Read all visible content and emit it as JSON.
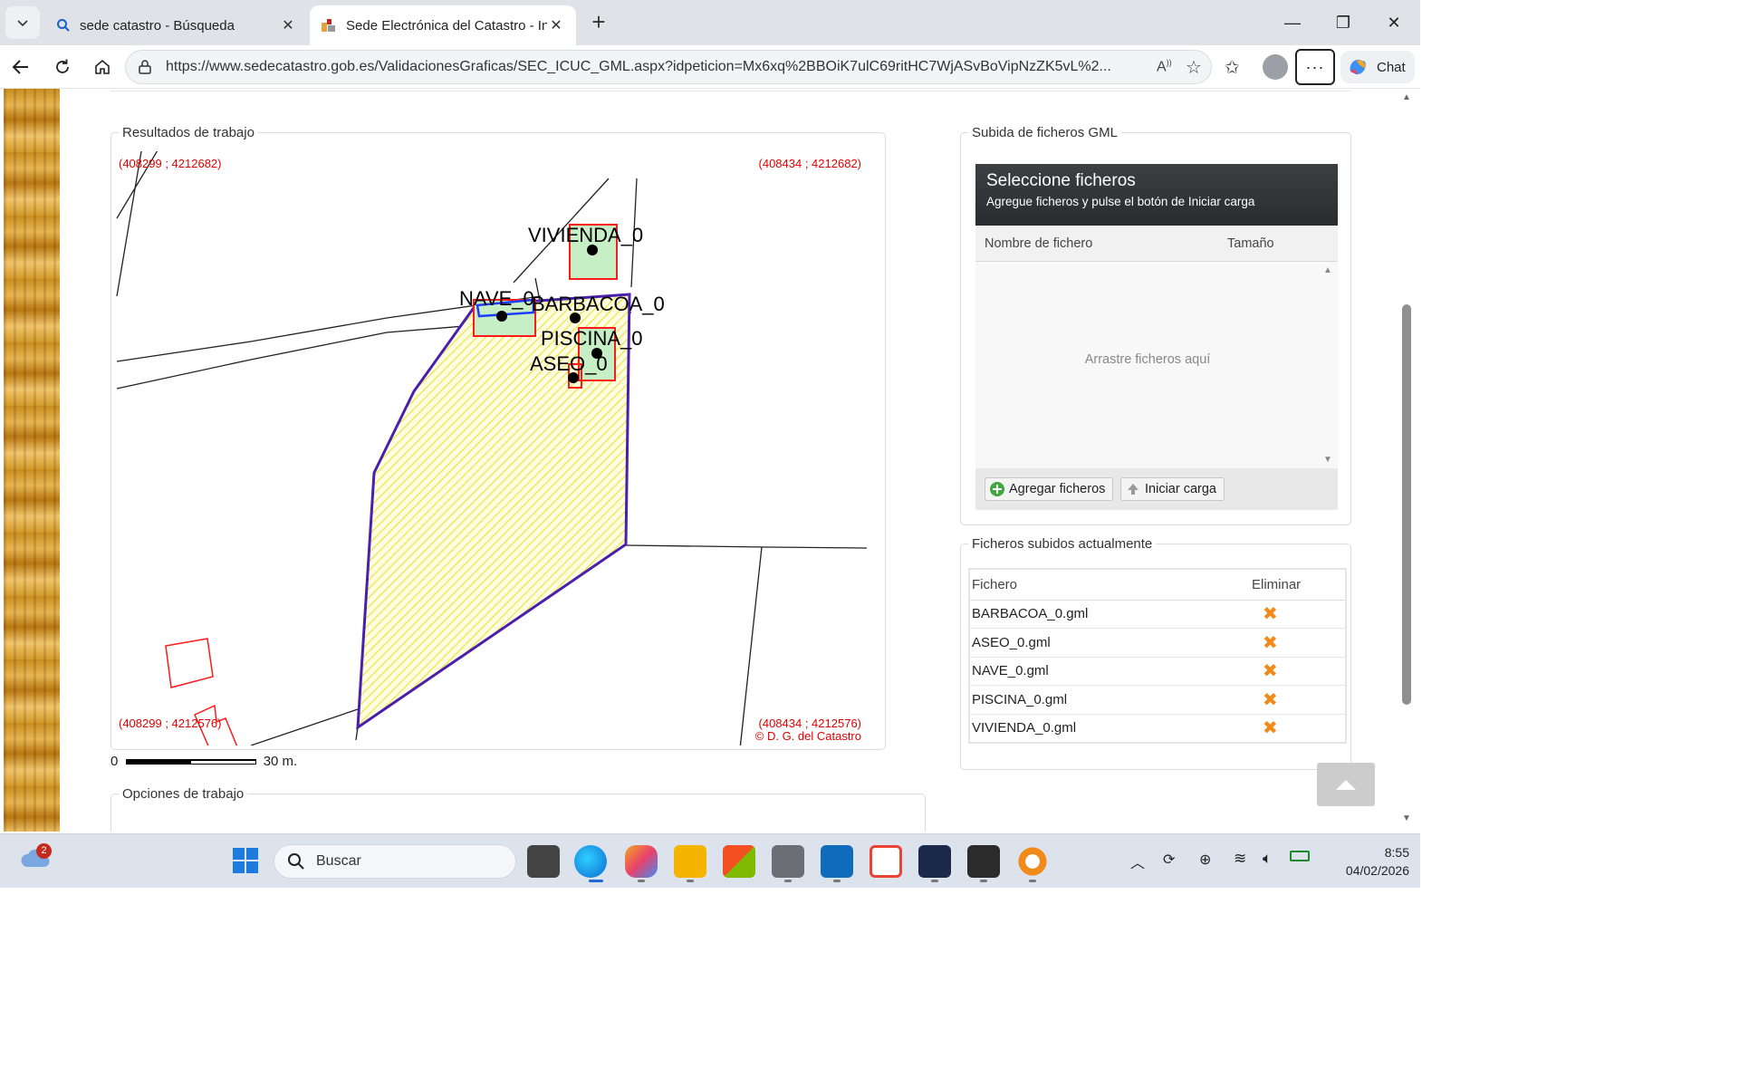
{
  "browser": {
    "tabs": [
      {
        "title": "sede catastro - Búsqueda",
        "active": false
      },
      {
        "title": "Sede Electrónica del Catastro - Información",
        "active": true
      }
    ],
    "url": "https://www.sedecatastro.gob.es/ValidacionesGraficas/SEC_ICUC_GML.aspx?idpeticion=Mx6xq%2BBOiK7ulC69ritHC7WjASvBoVipNzZK5vL%2...",
    "chat_label": "Chat"
  },
  "map": {
    "legend": "Resultados de trabajo",
    "coord_top_left": "(408299 ; 4212682)",
    "coord_top_right": "(408434 ; 4212682)",
    "coord_bottom_left": "(408299 ; 4212576)",
    "coord_bottom_right": "(408434 ; 4212576)",
    "copyright": "© D. G. del Catastro",
    "labels": {
      "vivienda": "VIVIENDA_0",
      "nave": "NAVE_0",
      "barbacoa": "BARBACOA_0",
      "piscina": "PISCINA_0",
      "aseo": "ASEO_0"
    },
    "scale_start": "0",
    "scale_end": "30 m."
  },
  "options": {
    "legend": "Opciones de trabajo"
  },
  "upload": {
    "legend": "Subida de ficheros GML",
    "header_title": "Seleccione ficheros",
    "header_subtitle": "Agregue ficheros y pulse el botón de Iniciar carga",
    "col_name": "Nombre de fichero",
    "col_size": "Tamaño",
    "drop_text": "Arrastre ficheros aquí",
    "add_button": "Agregar ficheros",
    "start_button": "Iniciar carga"
  },
  "uploaded": {
    "legend": "Ficheros subidos actualmente",
    "col_file": "Fichero",
    "col_delete": "Eliminar",
    "rows": [
      {
        "file": "BARBACOA_0.gml"
      },
      {
        "file": "ASEO_0.gml"
      },
      {
        "file": "NAVE_0.gml"
      },
      {
        "file": "PISCINA_0.gml"
      },
      {
        "file": "VIVIENDA_0.gml"
      }
    ]
  },
  "taskbar": {
    "search_placeholder": "Buscar",
    "time": "8:55",
    "date": "04/02/2026",
    "weather_badge": "2"
  },
  "colors": {
    "parcel_fill": "#fdfb9a",
    "parcel_outline": "#4b1fae",
    "building_outline": "#ff1a1a",
    "building_fill": "#c6efc6",
    "delete_icon": "#f28a1a"
  }
}
